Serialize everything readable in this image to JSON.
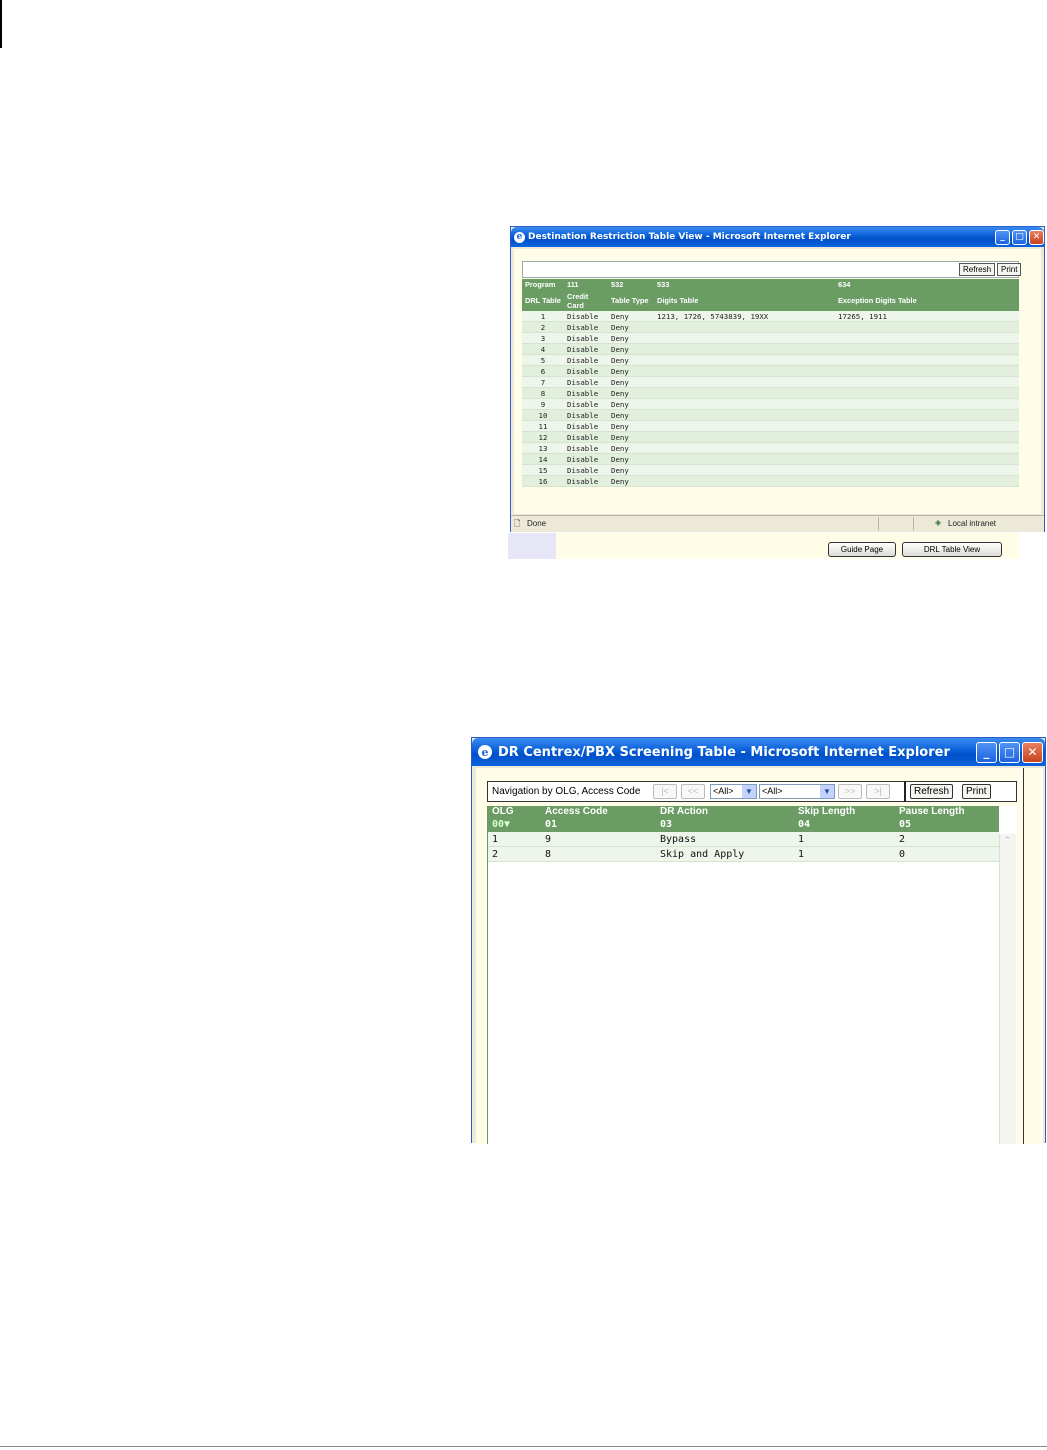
{
  "window1": {
    "title": "Destination Restriction Table View - Microsoft Internet Explorer",
    "refresh_label": "Refresh",
    "print_label": "Print",
    "program_row": [
      "Program",
      "111",
      "532",
      "533",
      "",
      "634"
    ],
    "header_row": [
      "DRL Table",
      "Credit Card",
      "Table Type",
      "Digits Table",
      "",
      "Exception Digits Table"
    ],
    "rows": [
      {
        "drl": "1",
        "credit": "Disable",
        "type": "Deny",
        "digits": "1213, 1726, 5743839, 19XX",
        "exception": "17265, 1911"
      },
      {
        "drl": "2",
        "credit": "Disable",
        "type": "Deny",
        "digits": "",
        "exception": ""
      },
      {
        "drl": "3",
        "credit": "Disable",
        "type": "Deny",
        "digits": "",
        "exception": ""
      },
      {
        "drl": "4",
        "credit": "Disable",
        "type": "Deny",
        "digits": "",
        "exception": ""
      },
      {
        "drl": "5",
        "credit": "Disable",
        "type": "Deny",
        "digits": "",
        "exception": ""
      },
      {
        "drl": "6",
        "credit": "Disable",
        "type": "Deny",
        "digits": "",
        "exception": ""
      },
      {
        "drl": "7",
        "credit": "Disable",
        "type": "Deny",
        "digits": "",
        "exception": ""
      },
      {
        "drl": "8",
        "credit": "Disable",
        "type": "Deny",
        "digits": "",
        "exception": ""
      },
      {
        "drl": "9",
        "credit": "Disable",
        "type": "Deny",
        "digits": "",
        "exception": ""
      },
      {
        "drl": "10",
        "credit": "Disable",
        "type": "Deny",
        "digits": "",
        "exception": ""
      },
      {
        "drl": "11",
        "credit": "Disable",
        "type": "Deny",
        "digits": "",
        "exception": ""
      },
      {
        "drl": "12",
        "credit": "Disable",
        "type": "Deny",
        "digits": "",
        "exception": ""
      },
      {
        "drl": "13",
        "credit": "Disable",
        "type": "Deny",
        "digits": "",
        "exception": ""
      },
      {
        "drl": "14",
        "credit": "Disable",
        "type": "Deny",
        "digits": "",
        "exception": ""
      },
      {
        "drl": "15",
        "credit": "Disable",
        "type": "Deny",
        "digits": "",
        "exception": ""
      },
      {
        "drl": "16",
        "credit": "Disable",
        "type": "Deny",
        "digits": "",
        "exception": ""
      }
    ],
    "status_text": "Done",
    "zone_text": "Local intranet"
  },
  "below_window1": {
    "guide_button": "Guide Page",
    "drl_button": "DRL Table View"
  },
  "window2": {
    "title": "DR Centrex/PBX Screening Table - Microsoft Internet Explorer",
    "nav_label": "Navigation by OLG, Access Code",
    "pager": {
      "first": "|<",
      "prev": "<<",
      "next": ">>",
      "last": ">|"
    },
    "select1_value": "<All>",
    "select2_value": "<All>",
    "refresh_label": "Refresh",
    "print_label": "Print",
    "columns": [
      "OLG",
      "Access Code",
      "DR Action",
      "Skip Length",
      "Pause Length"
    ],
    "column_codes": [
      "00▼",
      "01",
      "03",
      "04",
      "05"
    ],
    "rows": [
      [
        "1",
        "9",
        "Bypass",
        "1",
        "2"
      ],
      [
        "2",
        "8",
        "Skip and Apply",
        "1",
        "0"
      ]
    ]
  },
  "colors": {
    "header_green": "#6a9c64",
    "row_green": "#eef5ea",
    "page_cream": "#fffde8",
    "titlebar_blue": "#0a5fd8"
  }
}
